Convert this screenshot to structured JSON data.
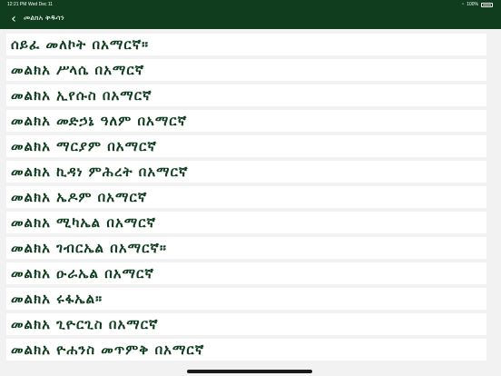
{
  "status": {
    "time": "12:21 PM",
    "date": "Wed Dec 11",
    "battery": "100%"
  },
  "nav": {
    "back_icon": "chevron-left-icon",
    "title": "መልክአ ቅዱሳን"
  },
  "list": [
    "ሰይፈ መለኮት በአማርኛ።",
    "መልክአ ሥላሴ በአማርኛ",
    "መልክአ ኢየሱስ በአማርኛ",
    "መልክአ መድኃኔ ዓለም በአማርኛ",
    "መልክአ ማርያም በአማርኛ",
    "መልክአ ኪዳነ ምሕረት በአማርኛ",
    "መልክአ ኤዶም በአማርኛ",
    "መልክአ ሚካኤል በአማርኛ",
    "መልክአ ገብርኤል በአማርኛ።",
    "መልክአ ዑራኤል በአማርኛ",
    "መልክአ ሩፋኤል።",
    "መልክአ ጊዮርጊስ በአማርኛ",
    "መልክአ ዮሐንስ መጥምቅ በአማርኛ"
  ],
  "colors": {
    "bar": "#0f3d1e",
    "text": "#0f3d1e",
    "background": "#f2f2f2"
  }
}
